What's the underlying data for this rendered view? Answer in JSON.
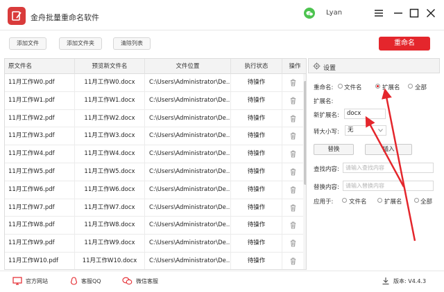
{
  "app": {
    "title": "金舟批量重命名软件",
    "username": "Lyan",
    "accent_color": "#e4262c",
    "icons": {
      "logo": "app-logo-icon",
      "wechat": "wechat-icon",
      "menu": "hamburger-menu-icon",
      "maximize": "maximize-icon",
      "close": "close-icon"
    }
  },
  "toolbar": {
    "add_file": "添加文件",
    "add_folder": "添加文件夹",
    "clear_list": "清除列表",
    "rename": "重命名"
  },
  "table": {
    "headers": [
      "原文件名",
      "预览新文件名",
      "文件位置",
      "执行状态",
      "操作"
    ],
    "rows": [
      {
        "original": "11月工作W0.pdf",
        "preview": "11月工作W0.docx",
        "location": "C:\\Users\\Administrator\\De...",
        "status": "待操作"
      },
      {
        "original": "11月工作W1.pdf",
        "preview": "11月工作W1.docx",
        "location": "C:\\Users\\Administrator\\De...",
        "status": "待操作"
      },
      {
        "original": "11月工作W2.pdf",
        "preview": "11月工作W2.docx",
        "location": "C:\\Users\\Administrator\\De...",
        "status": "待操作"
      },
      {
        "original": "11月工作W3.pdf",
        "preview": "11月工作W3.docx",
        "location": "C:\\Users\\Administrator\\De...",
        "status": "待操作"
      },
      {
        "original": "11月工作W4.pdf",
        "preview": "11月工作W4.docx",
        "location": "C:\\Users\\Administrator\\De...",
        "status": "待操作"
      },
      {
        "original": "11月工作W5.pdf",
        "preview": "11月工作W5.docx",
        "location": "C:\\Users\\Administrator\\De...",
        "status": "待操作"
      },
      {
        "original": "11月工作W6.pdf",
        "preview": "11月工作W6.docx",
        "location": "C:\\Users\\Administrator\\De...",
        "status": "待操作"
      },
      {
        "original": "11月工作W7.pdf",
        "preview": "11月工作W7.docx",
        "location": "C:\\Users\\Administrator\\De...",
        "status": "待操作"
      },
      {
        "original": "11月工作W8.pdf",
        "preview": "11月工作W8.docx",
        "location": "C:\\Users\\Administrator\\De...",
        "status": "待操作"
      },
      {
        "original": "11月工作W9.pdf",
        "preview": "11月工作W9.docx",
        "location": "C:\\Users\\Administrator\\De...",
        "status": "待操作"
      },
      {
        "original": "11月工作W10.pdf",
        "preview": "11月工作W10.docx",
        "location": "C:\\Users\\Administrator\\De...",
        "status": "待操作"
      }
    ]
  },
  "settings": {
    "title": "设置",
    "rename_label": "重命名:",
    "rename_options": [
      "文件名",
      "扩展名",
      "全部"
    ],
    "rename_selected": "扩展名",
    "ext_label": "扩展名:",
    "new_ext_label": "新扩展名:",
    "new_ext_value": "docx",
    "case_label": "转大小写:",
    "case_value": "无",
    "replace_btn": "替换",
    "insert_btn": "插入",
    "find_label": "查找内容:",
    "find_placeholder": "请输入查找内容",
    "replace_label": "替换内容:",
    "replace_placeholder": "请输入替换内容",
    "apply_label": "应用于:",
    "apply_options": [
      "文件名",
      "扩展名",
      "全部"
    ]
  },
  "footer": {
    "website": "官方网站",
    "qq": "客服QQ",
    "wechat_service": "微信客服",
    "version": "版本: V4.4.3"
  }
}
